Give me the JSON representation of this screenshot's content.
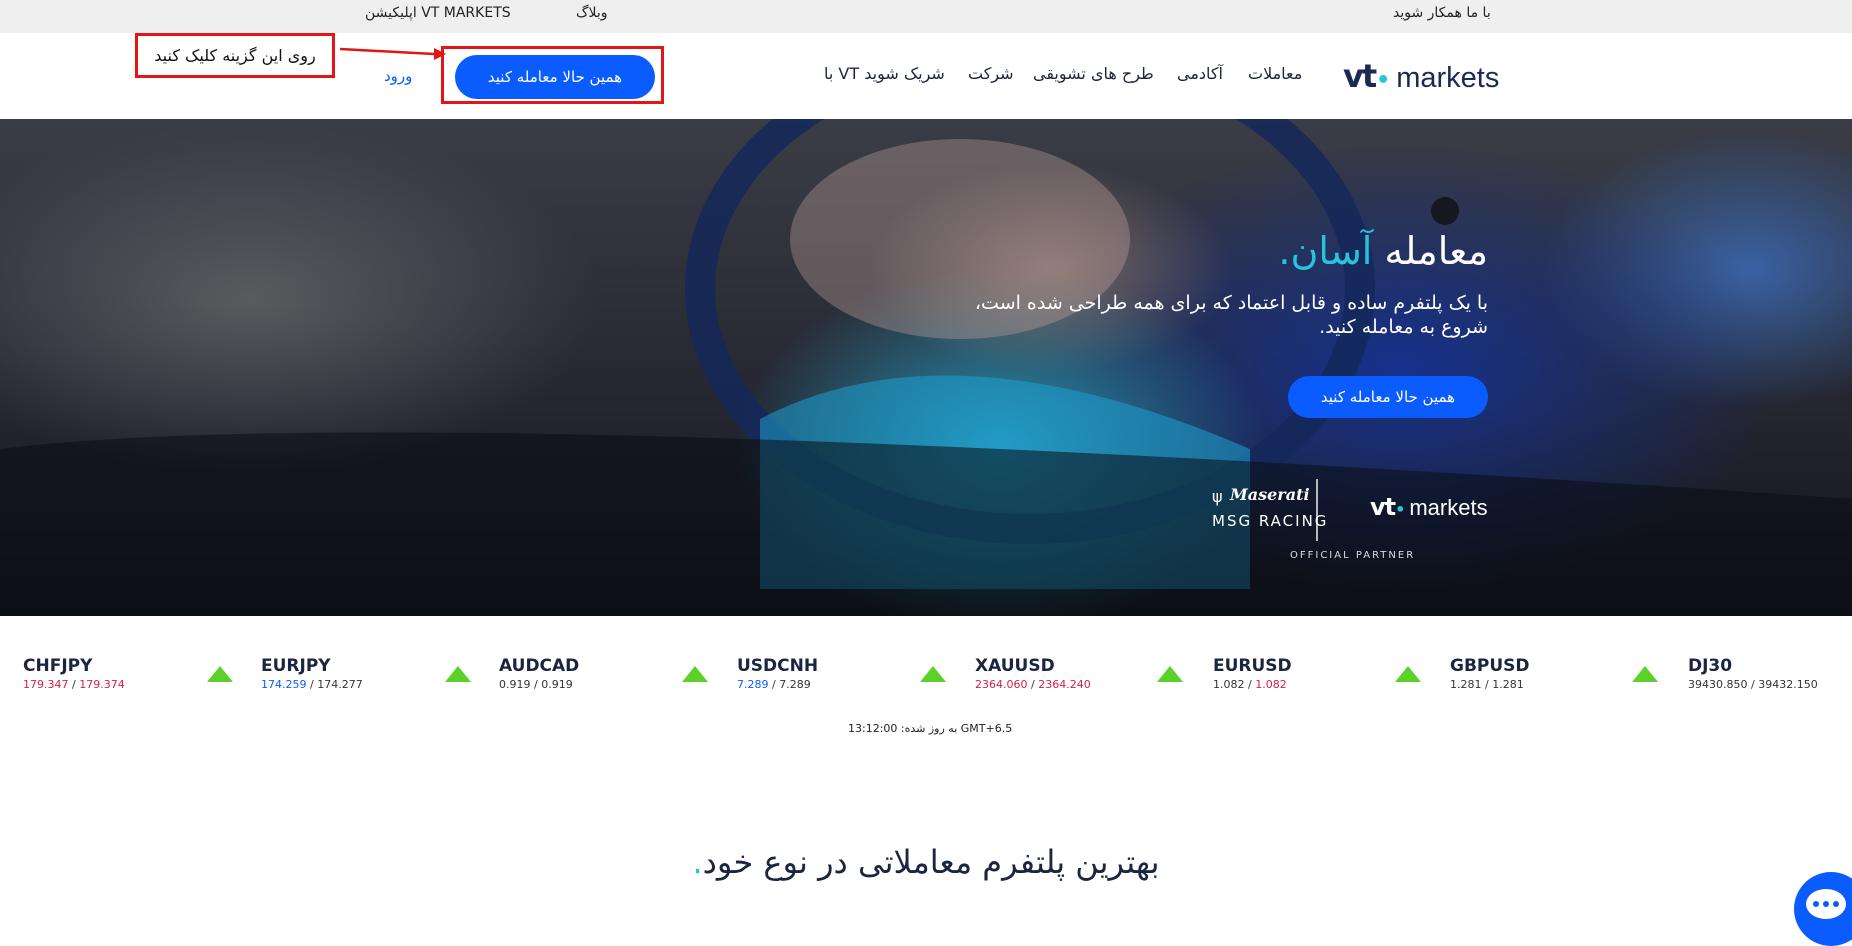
{
  "topbar": {
    "partner_link": "با ما همکار شوید",
    "blog_link": "وبلاگ",
    "app_link": "اپلیکیشن VT MARKETS"
  },
  "logo": {
    "vt": "vt",
    "markets": "markets"
  },
  "nav": {
    "items": [
      "معاملات",
      "آکادمی",
      "طرح های تشویقی",
      "شرکت",
      "با VT شریک شوید"
    ]
  },
  "header": {
    "cta_label": "همین حالا معامله کنید",
    "login_label": "ورود"
  },
  "annotation": {
    "label": "روی این گزینه کلیک کنید"
  },
  "hero": {
    "title_main": "معامله ",
    "title_accent": "آسان",
    "title_dot": ".",
    "subtitle": "با یک پلتفرم ساده و قابل اعتماد که برای همه طراحی شده است، شروع به معامله کنید.",
    "cta_label": "همین حالا معامله کنید",
    "partner_brand": "Maserati",
    "partner_racing": "MSG RACING",
    "partner_logo_vt": "vt",
    "partner_logo_markets": "markets",
    "partner_caption": "OFFICIAL PARTNER"
  },
  "ticker": [
    {
      "symbol": "CHFJPY",
      "bid": "179.347",
      "ask": "179.374",
      "bid_color": "red",
      "ask_color": "red"
    },
    {
      "symbol": "EURJPY",
      "bid": "174.259",
      "ask": "174.277",
      "bid_color": "blue",
      "ask_color": ""
    },
    {
      "symbol": "AUDCAD",
      "bid": "0.919",
      "ask": "0.919",
      "bid_color": "",
      "ask_color": ""
    },
    {
      "symbol": "USDCNH",
      "bid": "7.289",
      "ask": "7.289",
      "bid_color": "blue",
      "ask_color": ""
    },
    {
      "symbol": "XAUUSD",
      "bid": "2364.060",
      "ask": "2364.240",
      "bid_color": "red",
      "ask_color": "red"
    },
    {
      "symbol": "EURUSD",
      "bid": "1.082",
      "ask": "1.082",
      "bid_color": "",
      "ask_color": "red"
    },
    {
      "symbol": "GBPUSD",
      "bid": "1.281",
      "ask": "1.281",
      "bid_color": "",
      "ask_color": ""
    },
    {
      "symbol": "DJ30",
      "bid": "39430.850",
      "ask": "39432.150",
      "bid_color": "",
      "ask_color": ""
    }
  ],
  "updated": {
    "text": "13:12:00 :به روز شده GMT+6.5"
  },
  "section": {
    "title_main": "بهترین پلتفرم معاملاتی در نوع خود",
    "title_dot": "."
  },
  "colors": {
    "primary": "#0b5cff",
    "accent": "#26c6da",
    "up": "#5bd12a",
    "annotation": "#e31515"
  }
}
